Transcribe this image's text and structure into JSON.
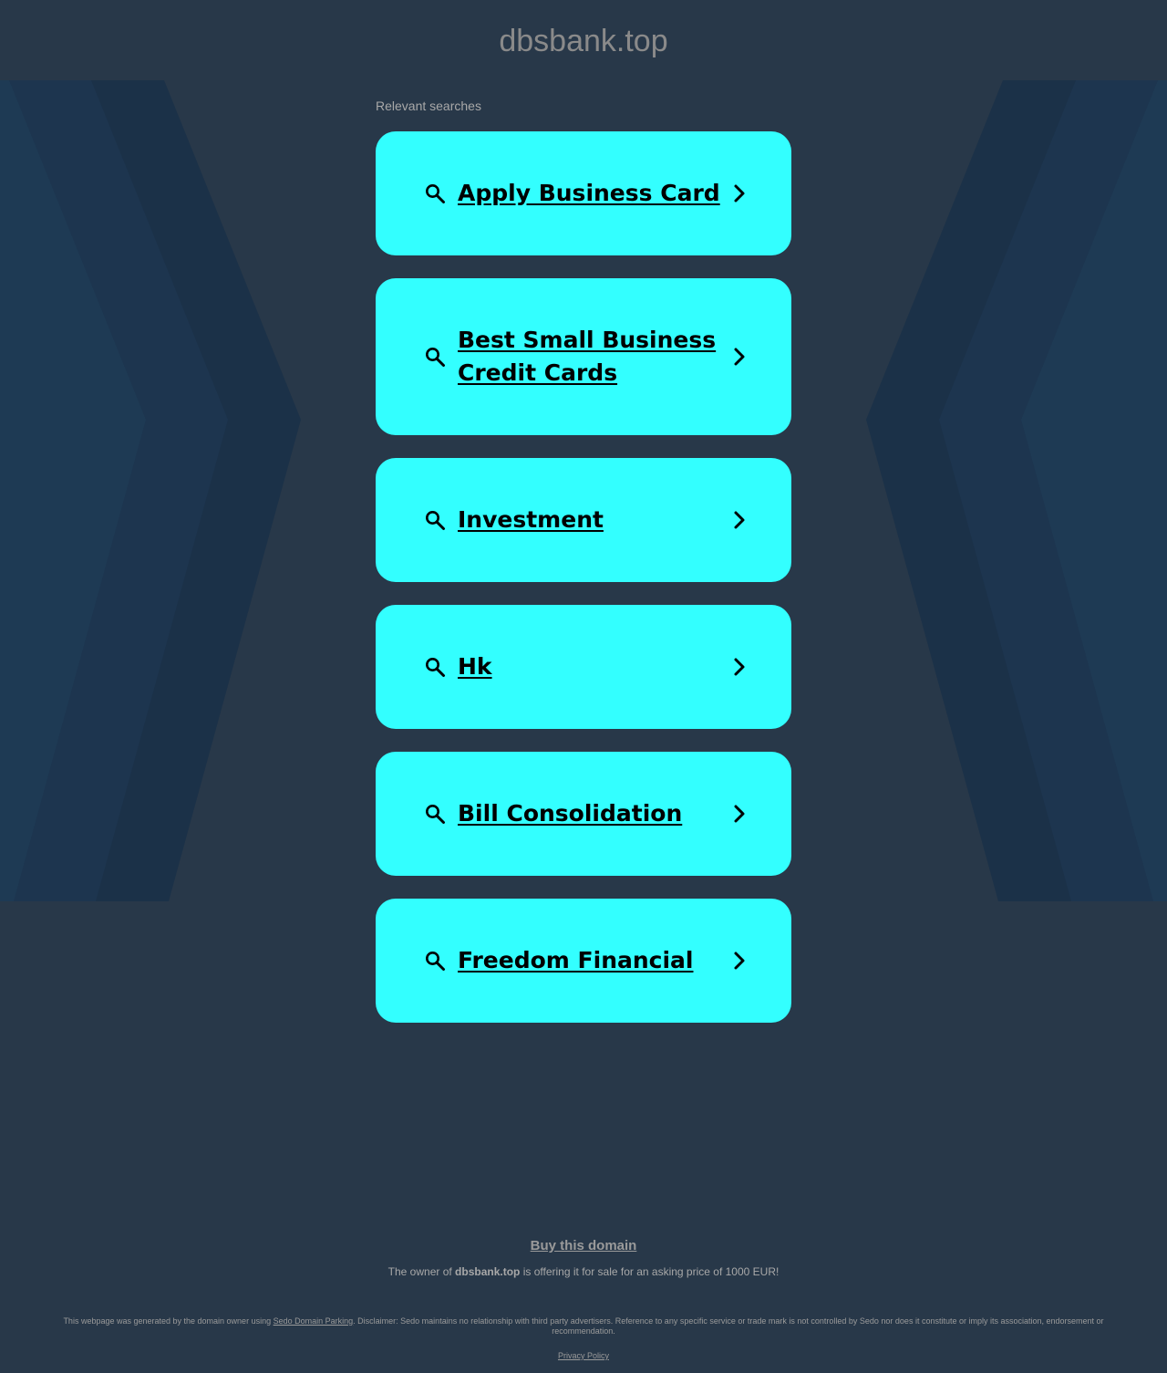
{
  "header": {
    "domain": "dbsbank.top"
  },
  "colors": {
    "background": "#283849",
    "band_dark": "#1b3148",
    "band_mid": "#1e3650",
    "card": "#33ffff",
    "muted_text": "#a8a8a8"
  },
  "relevant_label": "Relevant searches",
  "searches": [
    {
      "label": "Apply Business Card",
      "icon": "search-icon",
      "chevron": "chevron-right-icon"
    },
    {
      "label": "Best Small Business Credit Cards",
      "icon": "search-icon",
      "chevron": "chevron-right-icon"
    },
    {
      "label": "Investment",
      "icon": "search-icon",
      "chevron": "chevron-right-icon"
    },
    {
      "label": "Hk",
      "icon": "search-icon",
      "chevron": "chevron-right-icon"
    },
    {
      "label": "Bill Consolidation",
      "icon": "search-icon",
      "chevron": "chevron-right-icon"
    },
    {
      "label": "Freedom Financial",
      "icon": "search-icon",
      "chevron": "chevron-right-icon"
    }
  ],
  "footer": {
    "buy_link": "Buy this domain",
    "owner_prefix": "The owner of ",
    "owner_domain": "dbsbank.top",
    "owner_suffix": " is offering it for sale for an asking price of 1000 EUR!",
    "disclaimer_prefix": "This webpage was generated by the domain owner using ",
    "disclaimer_link": "Sedo Domain Parking",
    "disclaimer_suffix": ". Disclaimer: Sedo maintains no relationship with third party advertisers. Reference to any specific service or trade mark is not controlled by Sedo nor does it constitute or imply its association, endorsement or recommendation.",
    "privacy_link": "Privacy Policy"
  }
}
